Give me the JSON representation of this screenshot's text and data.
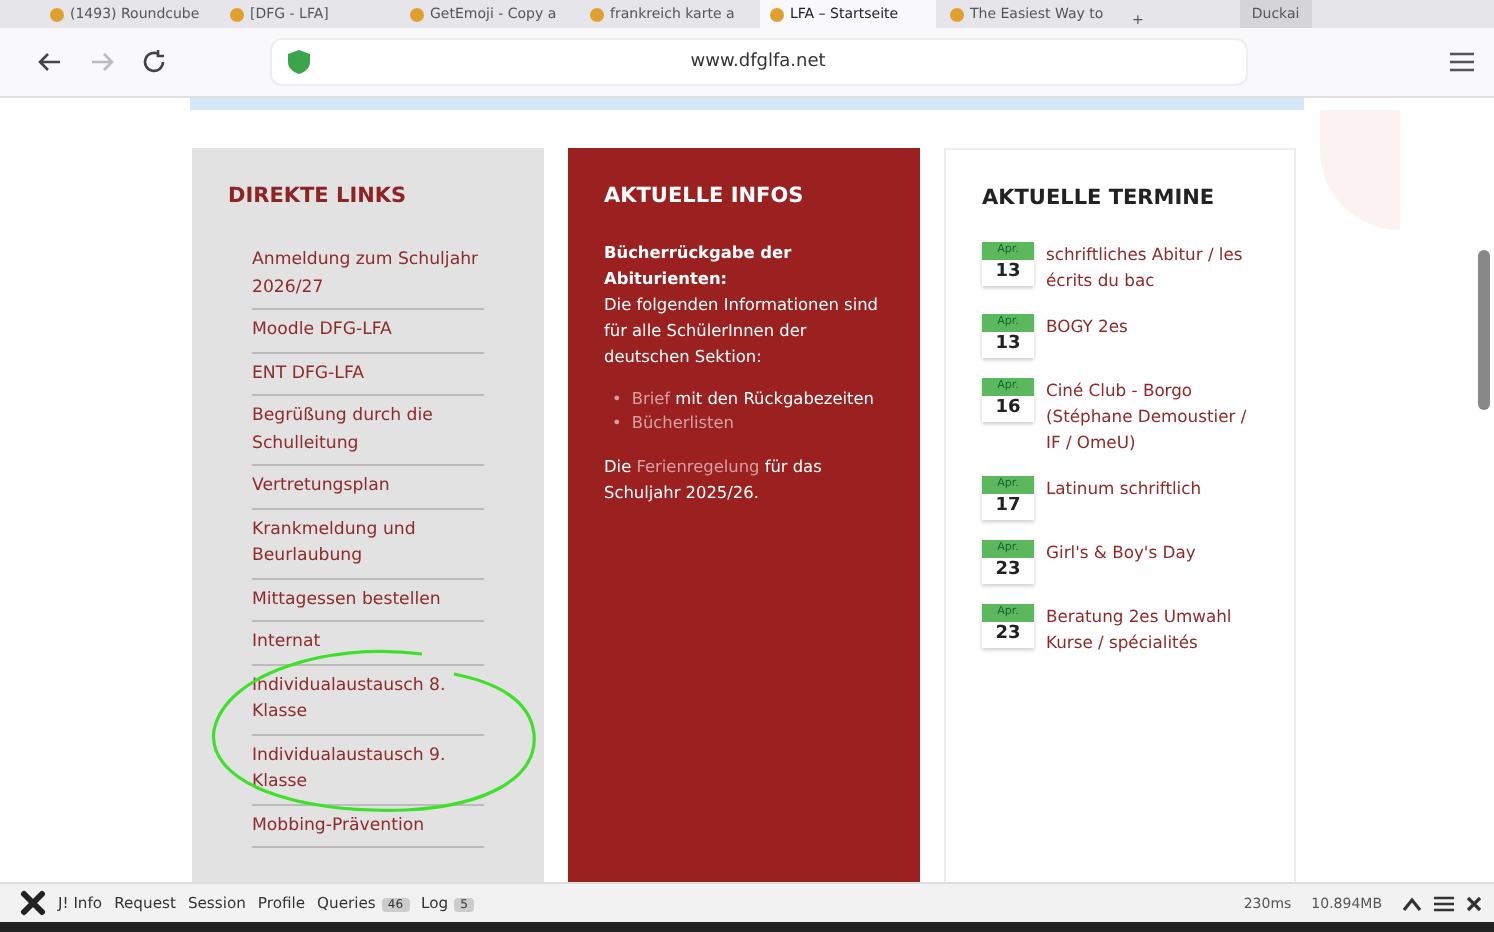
{
  "browser": {
    "tabs": [
      {
        "label": "(1493) Roundcube",
        "selected": false
      },
      {
        "label": "[DFG - LFA]",
        "selected": false
      },
      {
        "label": "GetEmoji - Copy a",
        "selected": false
      },
      {
        "label": "frankreich karte a",
        "selected": false
      },
      {
        "label": "LFA – Startseite",
        "selected": true
      },
      {
        "label": "The Easiest Way to",
        "selected": false
      }
    ],
    "new_tab": "+",
    "profile": "Duckai",
    "address": "www.dfglfa.net"
  },
  "links": {
    "title": "DIREKTE LINKS",
    "items": [
      "Anmeldung zum Schuljahr 2026/27",
      "Moodle DFG-LFA",
      "ENT DFG-LFA",
      "Begrüßung durch die Schulleitung",
      "Vertretungsplan",
      "Krankmeldung und Beurlaubung",
      "Mittagessen bestellen",
      "Internat",
      "Individualaustausch 8. Klasse",
      "Individualaustausch 9. Klasse",
      "Mobbing-Prävention"
    ]
  },
  "infos": {
    "title": "AKTUELLE INFOS",
    "heading": "Bücherrückgabe der Abiturienten:",
    "text": "Die folgenden Informationen sind für alle SchülerInnen der deutschen Sektion:",
    "list": [
      {
        "bullet": "•",
        "parts": [
          {
            "text": "Brief",
            "link": true
          },
          {
            "text": " mit den Rückgabezeiten",
            "link": false
          }
        ]
      },
      {
        "bullet": "•",
        "parts": [
          {
            "text": "Bücherlisten",
            "link": true
          }
        ]
      }
    ],
    "footer": [
      {
        "text": "Die ",
        "link": false
      },
      {
        "text": "Ferienregelung",
        "link": true
      },
      {
        "text": " für das Schuljahr 2025/26.",
        "link": false
      }
    ]
  },
  "events": {
    "title": "AKTUELLE TERMINE",
    "items": [
      {
        "month": "Apr.",
        "day": "13",
        "title": "schriftliches Abitur / les écrits du bac"
      },
      {
        "month": "Apr.",
        "day": "13",
        "title": "BOGY 2es"
      },
      {
        "month": "Apr.",
        "day": "16",
        "title": "Ciné Club - Borgo (Stéphane Demoustier / IF / OmeU)"
      },
      {
        "month": "Apr.",
        "day": "17",
        "title": "Latinum schriftlich"
      },
      {
        "month": "Apr.",
        "day": "23",
        "title": "Girl's & Boy's Day"
      },
      {
        "month": "Apr.",
        "day": "23",
        "title": "Beratung 2es Umwahl Kurse / spécialités"
      }
    ]
  },
  "debug_bar": {
    "items": [
      {
        "label": "J! Info"
      },
      {
        "label": "Request"
      },
      {
        "label": "Session"
      },
      {
        "label": "Profile"
      },
      {
        "label": "Queries",
        "count": "46"
      },
      {
        "label": "Log",
        "count": "5"
      }
    ],
    "time": "230ms",
    "memory": "10.894MB"
  }
}
